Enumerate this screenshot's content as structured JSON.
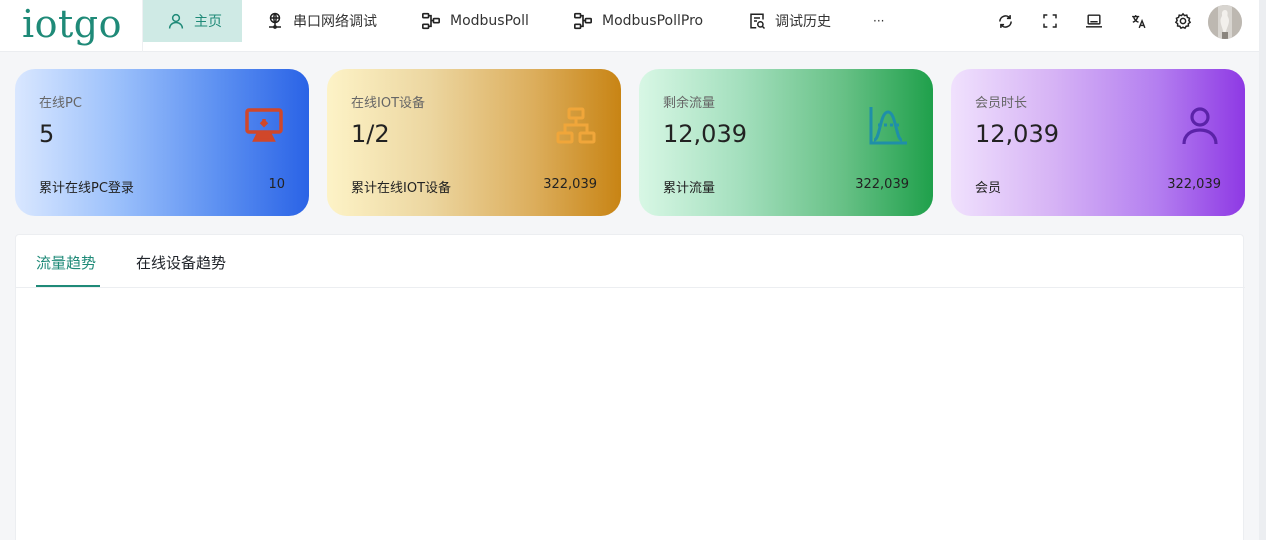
{
  "app": {
    "logo_text": "iotgo"
  },
  "nav": {
    "items": [
      {
        "label": "主页",
        "icon": "user-icon",
        "active": true
      },
      {
        "label": "串口网络调试",
        "icon": "network-globe-icon",
        "active": false
      },
      {
        "label": "ModbusPoll",
        "icon": "modbus-flow-icon",
        "active": false
      },
      {
        "label": "ModbusPollPro",
        "icon": "modbus-flow-icon",
        "active": false
      },
      {
        "label": "调试历史",
        "icon": "history-search-icon",
        "active": false
      },
      {
        "label": "···",
        "icon": "more-icon",
        "active": false
      }
    ]
  },
  "toolbar": {
    "icons": [
      "refresh-icon",
      "fullscreen-icon",
      "laptop-icon",
      "translate-icon",
      "settings-gear-icon"
    ],
    "avatar": "user-avatar"
  },
  "stats": [
    {
      "title": "在线PC",
      "value": "5",
      "footer_label": "累计在线PC登录",
      "footer_value": "10",
      "icon": "monitor-icon",
      "icon_color": "#d0472a"
    },
    {
      "title": "在线IOT设备",
      "value": "1/2",
      "footer_label": "累计在线IOT设备",
      "footer_value": "322,039",
      "icon": "hierarchy-icon",
      "icon_color": "#f0a63a"
    },
    {
      "title": "剩余流量",
      "value": "12,039",
      "footer_label": "累计流量",
      "footer_value": "322,039",
      "icon": "bell-curve-chart-icon",
      "icon_color": "#1f8fa8"
    },
    {
      "title": "会员时长",
      "value": "12,039",
      "footer_label": "会员",
      "footer_value": "322,039",
      "icon": "person-icon",
      "icon_color": "#5b23a8"
    }
  ],
  "panel": {
    "tabs": [
      {
        "label": "流量趋势",
        "active": true
      },
      {
        "label": "在线设备趋势",
        "active": false
      }
    ]
  },
  "colors": {
    "accent": "#1f8a78",
    "active_nav_bg": "#cfeae5"
  }
}
